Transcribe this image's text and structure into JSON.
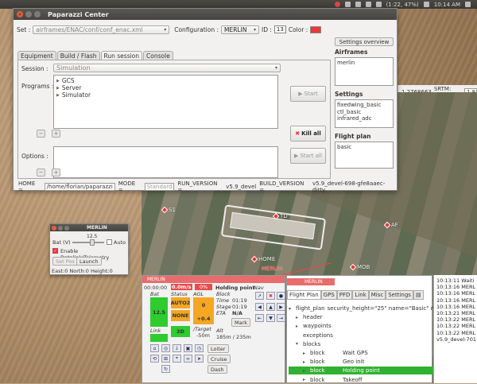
{
  "top_panel": {
    "status": "(1:22, 47%)",
    "clock": "10:14 AM"
  },
  "paparazzi_center": {
    "title": "Paparazzi Center",
    "set_label": "Set :",
    "set_value": "airframes/ENAC/conf/conf_enac.xml",
    "configuration_label": "Configuration :",
    "configuration_value": "MERLIN",
    "id_label": "ID :",
    "id_value": "13",
    "color_label": "Color :",
    "color_value": "#e83a3a",
    "tabs": [
      "Equipment",
      "Build / Flash",
      "Run session",
      "Console"
    ],
    "active_tab": "Run session",
    "session_label": "Session :",
    "session_value": "Simulation",
    "programs_label": "Programs :",
    "programs": [
      "GCS",
      "Server",
      "Simulator"
    ],
    "start_button": "Start",
    "kill_all_button": "Kill all",
    "options_label": "Options :",
    "start_all_button": "Start all",
    "minus_icon": "−",
    "plus_icon": "+",
    "side": {
      "settings_overview_button": "Settings overview",
      "airframes_title": "Airframes",
      "airframes": [
        "merlin"
      ],
      "settings_title": "Settings",
      "settings": [
        "fixedwing_basic",
        "ctl_basic",
        "infrared_adc"
      ],
      "flight_plan_title": "Flight plan",
      "flight_plan": [
        "basic"
      ]
    },
    "status": {
      "home_label": "HOME =",
      "home_value": "/home/florian/paparazzi",
      "mode_label": "MODE =",
      "mode_value": "Standard",
      "run_version_label": "RUN_VERSION =",
      "run_version_value": "v5.9_devel",
      "build_version_label": "BUILD_VERSION =",
      "build_version_value": "v5.9_devel-698-gfe8aaec-dirty"
    }
  },
  "map": {
    "coords": "1.2768663",
    "srtm_label": "SRTM: N/A",
    "zoom_value": "1.8",
    "waypoints": [
      "S1",
      "TD",
      "AF",
      "HOME",
      "MOB"
    ],
    "aircraft_label": "MERLIN"
  },
  "merlin_sim": {
    "title": "MERLIN",
    "bat_label": "Bat (V)",
    "bat_value": "12.5",
    "auto_label": "Auto",
    "enable_datalink_label": "Enable Datalink/Telemetry",
    "set_pos_button": "Set Pos",
    "launch_button": "Launch",
    "position_text": "East:0 North:0 Height:0"
  },
  "strip": {
    "header": "MERLIN",
    "time": "00:00:00",
    "speed": "0.0m/s",
    "throttle": "0%",
    "block_name": "Holding point",
    "nav_label": "Nav",
    "bat_label": "Bat",
    "bat_value": "12.5",
    "status_label": "Status",
    "status_auto": "AUTO2",
    "status_none": "NONE",
    "status_3d": "3D",
    "agl_label": "AGL",
    "agl_value": "0",
    "agl_delta": "+0.4",
    "block_label": "Block",
    "time_label": "Time",
    "block_time": "01:19",
    "stage_label": "Stage",
    "stage_time": "01:19",
    "eta_label": "ETA",
    "eta_value": "N/A",
    "mark_button": "Mark",
    "link_label": "Link",
    "target_label": "/Target",
    "target_value": "-50m",
    "alt_label": "Alt",
    "alt_value": "185m / 235m",
    "loiter_button": "Loiter",
    "cruise_button": "Cruise",
    "dash_button": "Dash",
    "colors": {
      "green": "#2ecc2e",
      "orange": "#f5a623",
      "red": "#e94b4b"
    }
  },
  "flight_plan": {
    "header": "MERLIN",
    "tabs": [
      "Flight Plan",
      "GPS",
      "PFD",
      "Link",
      "Misc",
      "Settings"
    ],
    "active_tab": "Flight Plan",
    "tree": [
      {
        "indent": 0,
        "exp": "▾",
        "label": "flight_plan",
        "value": "security_height=\"25\" name=\"Basic\" max"
      },
      {
        "indent": 1,
        "exp": "▸",
        "label": "header",
        "value": ""
      },
      {
        "indent": 1,
        "exp": "▸",
        "label": "waypoints",
        "value": ""
      },
      {
        "indent": 1,
        "exp": "",
        "label": "exceptions",
        "value": ""
      },
      {
        "indent": 1,
        "exp": "▾",
        "label": "blocks",
        "value": ""
      },
      {
        "indent": 2,
        "exp": "▸",
        "label": "block",
        "value": "Wait GPS"
      },
      {
        "indent": 2,
        "exp": "▸",
        "label": "block",
        "value": "Geo init"
      },
      {
        "indent": 2,
        "exp": "▸",
        "label": "block",
        "value": "Holding point",
        "selected": true
      },
      {
        "indent": 2,
        "exp": "▸",
        "label": "block",
        "value": "Takeoff"
      }
    ]
  },
  "console": {
    "lines": [
      "10:13:11 Waiti",
      "10:13:16 MERL",
      "10:13:16 MERL",
      "10:13:16 MERL",
      "10:13:16 MERL",
      "10:13:21 MERL",
      "10:13:22 MERL",
      "10:13:22 MERL",
      "10:13:22 MERL",
      "v5.9_devel-701"
    ]
  }
}
